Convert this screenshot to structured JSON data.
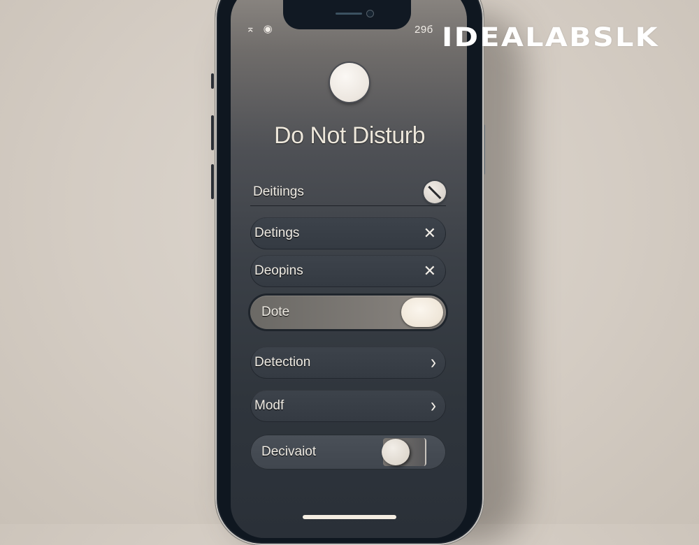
{
  "watermark": "IDEALABSLK",
  "status_bar": {
    "left_icons": [
      "signal-icon",
      "wifi-icon"
    ],
    "left_glyphs": [
      "⌅",
      "◉"
    ],
    "time": "29б"
  },
  "header": {
    "title": "Do Not Disturb"
  },
  "settings": {
    "items": [
      {
        "label": "Deitiings",
        "control": "block-toggle",
        "icon": "block-icon"
      },
      {
        "label": "Detings",
        "control": "close",
        "icon_glyph": "✕"
      },
      {
        "label": "Deopins",
        "control": "close",
        "icon_glyph": "✕"
      },
      {
        "label": "Dote",
        "control": "toggle",
        "state": "on"
      },
      {
        "label": "Detection",
        "control": "chevron",
        "icon_glyph": "›"
      },
      {
        "label": "Modf",
        "control": "chevron",
        "icon_glyph": "›"
      },
      {
        "label": "Decivaiot",
        "control": "toggle",
        "state": "off"
      }
    ]
  },
  "colors": {
    "background": "#d6cfc6",
    "phone_frame": "#0f1720",
    "screen_top": "#8e8984",
    "screen_bottom": "#2a3038",
    "text": "#f0ece4",
    "knob": "#efe6d8"
  }
}
